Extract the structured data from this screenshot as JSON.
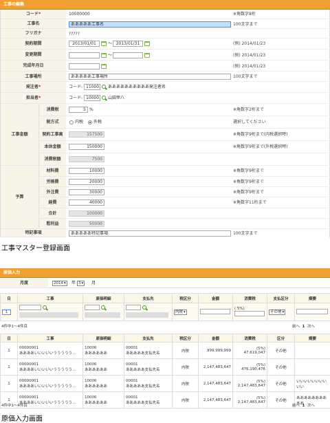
{
  "edit": {
    "title": "工事の編集",
    "labels": {
      "code": "コード",
      "name": "工事名",
      "kana": "フリガナ",
      "period": "契約期間",
      "change_period": "変更期間",
      "completion": "完成年月日",
      "place": "工事場所",
      "orderer": "発注者",
      "manager": "担当者",
      "amount": "工事金額",
      "tax_rate": "消費税",
      "tax_method": "税方式",
      "contract_amount": "契約工事高",
      "base_amount": "本体金額",
      "tax_amount": "消費税額",
      "budget": "予算",
      "material": "材料費",
      "labor": "労務費",
      "outsource": "外注費",
      "expense": "経費",
      "total": "合計",
      "gross_profit": "粗利益",
      "special": "特記事項"
    },
    "values": {
      "code": "10000000",
      "name": "あああああ工事名",
      "kana": "?????",
      "period_from": "2013/01/01",
      "period_to": "2013/01/31",
      "place": "あああああ工事場所",
      "orderer_code": "11000",
      "orderer_name": "ああああああああああ発注者名",
      "manager_code": "10000",
      "manager_name": "山田甲八",
      "tax_rate": "5",
      "tax_in": "内税",
      "tax_out": "外税",
      "contract_amount": "157500",
      "base_amount": "150000",
      "tax_amount": "7500",
      "material": "10000",
      "labor": "20000",
      "outsource": "30000",
      "expense": "40000",
      "total": "100000",
      "gross_profit": "50000",
      "special": "あああああ特記事項"
    },
    "code_prefix": "コード:",
    "tilde": "〜",
    "percent": "%",
    "notes": {
      "code": "※角数字8桁",
      "name": "100文字まで",
      "date_ex": "(例) 2014/01/23",
      "place": "100文字まで",
      "tax_rate": "※角数字2桁まで",
      "tax_method": "選択してください",
      "contract": "※角数字9桁まで(内税選択時)",
      "base": "※角数字9桁まで(外税選択時)",
      "material": "※角数字9桁まで",
      "labor": "※角数字9桁まで",
      "outsource": "※角数字9桁まで",
      "expense": "※角数字11桁まで",
      "special": "100文字まで"
    }
  },
  "caption1": "工事マスター登録画面",
  "cost": {
    "title": "原価入力",
    "month_label": "月度",
    "year": "2014",
    "year_suffix": "年",
    "month": "3",
    "month_suffix": "月",
    "columns": [
      "日",
      "工事",
      "原価明細",
      "支払先",
      "税区分",
      "金額",
      "消費税",
      "支払区分",
      "摘要"
    ],
    "entry": {
      "day": "1",
      "tax": "内税",
      "rate": "(  5%)",
      "pay": "その他"
    },
    "range_text": "4件中1〜4件目",
    "pager": {
      "prev": "前へ",
      "page": "1",
      "next": "次へ"
    },
    "list_columns": [
      "日",
      "工事",
      "原価明細",
      "支払先",
      "税区分",
      "金額",
      "消費税",
      "区分",
      "摘要"
    ],
    "rows": [
      {
        "day": "1",
        "proj_code": "00000001",
        "proj_name": "ああああいいいいいううううう...",
        "detail_code": "10006",
        "detail_name": "ああああああ",
        "payee_code": "00001",
        "payee_name": "あああああ支払先名",
        "tax": "内税",
        "amount": "999,999,999",
        "rate": "(5%)",
        "tax_amt": "47,619,047",
        "kubun": "その他",
        "memo": ""
      },
      {
        "day": "1",
        "proj_code": "00000001",
        "proj_name": "ああああいいいいいううううう...",
        "detail_code": "10006",
        "detail_name": "ああああああ",
        "payee_code": "00001",
        "payee_name": "あああああ支払先名",
        "tax": "内税",
        "amount": "2,147,483,647",
        "rate": "(5%)",
        "tax_amt": "476,190,476",
        "kubun": "その他",
        "memo": ""
      },
      {
        "day": "1",
        "proj_code": "00000001",
        "proj_name": "ああああいいいいいううううう...",
        "detail_code": "10006",
        "detail_name": "ああああああ",
        "payee_code": "00001",
        "payee_name": "あああああ支払先名",
        "tax": "内税",
        "amount": "2,147,483,647",
        "rate": "(5%)",
        "tax_amt": "2,147,483,647",
        "kubun": "その他",
        "memo": "いいいいいいいいいい"
      },
      {
        "day": "1",
        "proj_code": "00000001",
        "proj_name": "ああああいいいいいううううう...",
        "detail_code": "10006",
        "detail_name": "ああああああ",
        "payee_code": "00001",
        "payee_name": "あああああ支払先名",
        "tax": "内税",
        "amount": "2,147,483,647",
        "rate": "(5%)",
        "tax_amt": "2,147,483,647",
        "kubun": "その他",
        "memo": "ああああああああああ"
      }
    ]
  },
  "caption2": "原価入力画面"
}
